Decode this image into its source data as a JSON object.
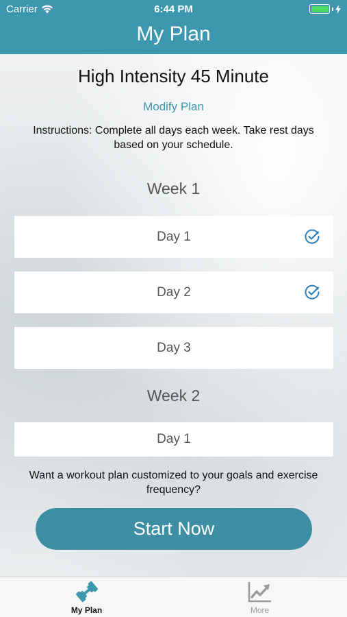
{
  "status_bar": {
    "carrier": "Carrier",
    "time": "6:44 PM"
  },
  "nav": {
    "title": "My Plan"
  },
  "plan": {
    "title": "High Intensity 45 Minute",
    "modify_label": "Modify Plan",
    "instructions": "Instructions: Complete all days each week. Take rest days based on your schedule."
  },
  "weeks": [
    {
      "label": "Week 1",
      "days": [
        {
          "label": "Day 1",
          "completed": true
        },
        {
          "label": "Day 2",
          "completed": true
        },
        {
          "label": "Day 3",
          "completed": false
        }
      ]
    },
    {
      "label": "Week 2",
      "days": [
        {
          "label": "Day 1",
          "completed": false
        }
      ]
    }
  ],
  "promo": {
    "text": "Want a workout plan customized to your goals and exercise frequency?",
    "button_label": "Start Now"
  },
  "tabbar": {
    "items": [
      {
        "label": "My Plan",
        "icon": "dumbbell-icon",
        "active": true
      },
      {
        "label": "More",
        "icon": "chart-trend-icon",
        "active": false
      }
    ]
  },
  "colors": {
    "accent": "#3d97ae",
    "button": "#3d8ea3",
    "check": "#2f7fb8"
  }
}
